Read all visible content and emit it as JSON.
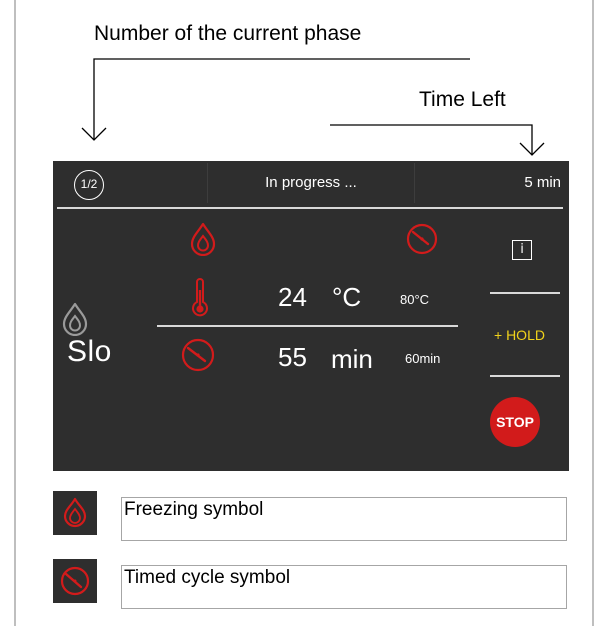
{
  "callouts": {
    "phase_number": "Number of the current phase",
    "time_left": "Time Left"
  },
  "screen": {
    "top_bar": {
      "phase": "1/2",
      "status": "In progress ...",
      "time_left": "5 min"
    },
    "mode": {
      "label": "Slo",
      "icon": "freezing-icon"
    },
    "temperature": {
      "icon": "thermometer-icon",
      "value": "24",
      "unit": "°C",
      "target": "80°C"
    },
    "time": {
      "icon": "timer-icon",
      "value": "55",
      "unit": "min",
      "target": "60min"
    },
    "status_icons": [
      "freezing-icon",
      "timer-icon"
    ],
    "buttons": {
      "info": "i",
      "hold": "+ HOLD",
      "stop": "STOP"
    },
    "colors": {
      "background": "#2e2e2e",
      "accent_red": "#d21b1b",
      "hold_yellow": "#f0d21b"
    }
  },
  "legend": [
    {
      "icon": "freezing-icon",
      "label": "Freezing symbol"
    },
    {
      "icon": "timer-icon",
      "label": "Timed cycle symbol"
    }
  ]
}
